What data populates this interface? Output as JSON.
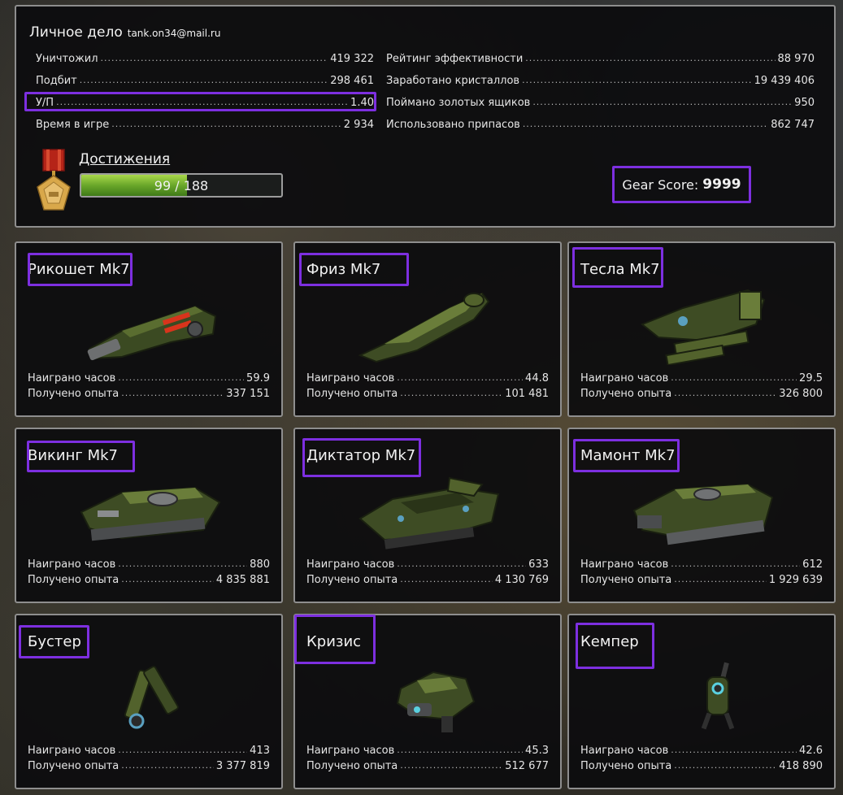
{
  "profile": {
    "title": "Личное дело",
    "email": "tank.on34@mail.ru",
    "left_stats": [
      {
        "label": "Уничтожил",
        "value": "419 322"
      },
      {
        "label": "Подбит",
        "value": "298 461"
      },
      {
        "label": "У/П",
        "value": "1.40"
      },
      {
        "label": "Время в игре",
        "value": "2 934"
      }
    ],
    "right_stats": [
      {
        "label": "Рейтинг эффективности",
        "value": "88 970"
      },
      {
        "label": "Заработано кристаллов",
        "value": "19 439 406"
      },
      {
        "label": "Поймано золотых ящиков",
        "value": "950"
      },
      {
        "label": "Использовано припасов",
        "value": "862 747"
      }
    ],
    "achievements": {
      "label": "Достижения",
      "progress_text": "99 / 188",
      "current": 99,
      "total": 188
    },
    "gear_score": {
      "label": "Gear Score:",
      "value": "9999"
    }
  },
  "cards": [
    {
      "name": "Рикошет Mk7",
      "kind": "turret-ricochet",
      "hours_label": "Наиграно часов",
      "hours": "59.9",
      "xp_label": "Получено опыта",
      "xp": "337 151"
    },
    {
      "name": "Фриз Mk7",
      "kind": "turret-freeze",
      "hours_label": "Наиграно часов",
      "hours": "44.8",
      "xp_label": "Получено опыта",
      "xp": "101 481"
    },
    {
      "name": "Тесла Mk7",
      "kind": "turret-tesla",
      "hours_label": "Наиграно часов",
      "hours": "29.5",
      "xp_label": "Получено опыта",
      "xp": "326 800"
    },
    {
      "name": "Викинг Mk7",
      "kind": "hull-viking",
      "hours_label": "Наиграно часов",
      "hours": "880",
      "xp_label": "Получено опыта",
      "xp": "4 835 881"
    },
    {
      "name": "Диктатор Mk7",
      "kind": "hull-dictator",
      "hours_label": "Наиграно часов",
      "hours": "633",
      "xp_label": "Получено опыта",
      "xp": "4 130 769"
    },
    {
      "name": "Мамонт Mk7",
      "kind": "hull-mammoth",
      "hours_label": "Наиграно часов",
      "hours": "612",
      "xp_label": "Получено опыта",
      "xp": "1 929 639"
    },
    {
      "name": "Бустер",
      "kind": "drone-booster",
      "hours_label": "Наиграно часов",
      "hours": "413",
      "xp_label": "Получено опыта",
      "xp": "3 377 819"
    },
    {
      "name": "Кризис",
      "kind": "drone-crisis",
      "hours_label": "Наиграно часов",
      "hours": "45.3",
      "xp_label": "Получено опыта",
      "xp": "512 677"
    },
    {
      "name": "Кемпер",
      "kind": "drone-camper",
      "hours_label": "Наиграно часов",
      "hours": "42.6",
      "xp_label": "Получено опыта",
      "xp": "418 890"
    }
  ],
  "colors": {
    "highlight": "#7d2fe0",
    "panel_border": "#8e8e8e",
    "progress_fill": "#7bb832"
  }
}
